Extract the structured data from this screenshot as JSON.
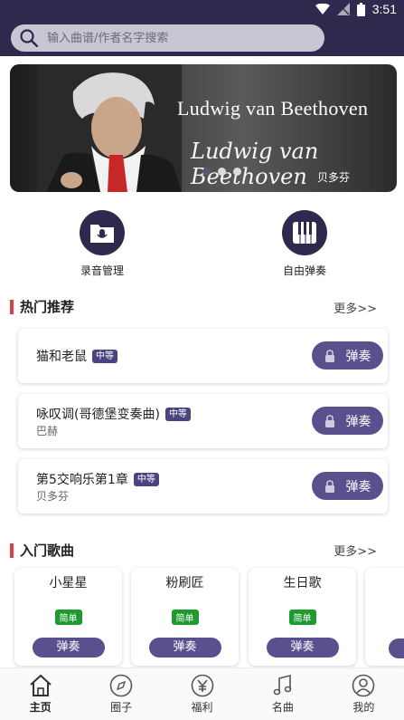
{
  "status": {
    "time": "3:51"
  },
  "search": {
    "placeholder": "输入曲谱/作者名字搜索"
  },
  "banner": {
    "title": "Ludwig van Beethoven",
    "signature": "Ludwig van Beethoven",
    "subtitle": "贝多芬"
  },
  "quick": [
    {
      "label": "录音管理",
      "icon": "microphone-folder-icon"
    },
    {
      "label": "自由弹奏",
      "icon": "piano-icon"
    }
  ],
  "hot": {
    "title": "热门推荐",
    "more": "更多>>",
    "items": [
      {
        "name": "猫和老鼠",
        "level": "中等",
        "author": "",
        "button": "弹奏"
      },
      {
        "name": "咏叹调(哥德堡变奏曲)",
        "level": "中等",
        "author": "巴赫",
        "button": "弹奏"
      },
      {
        "name": "第5交响乐第1章",
        "level": "中等",
        "author": "贝多芬",
        "button": "弹奏"
      }
    ]
  },
  "intro": {
    "title": "入门歌曲",
    "more": "更多>>",
    "items": [
      {
        "name": "小星星",
        "level": "简单",
        "button": "弹奏"
      },
      {
        "name": "粉刷匠",
        "level": "简单",
        "button": "弹奏"
      },
      {
        "name": "生日歌",
        "level": "简单",
        "button": "弹奏"
      }
    ]
  },
  "tabs": [
    {
      "label": "主页",
      "icon": "home-icon"
    },
    {
      "label": "圈子",
      "icon": "compass-icon"
    },
    {
      "label": "福利",
      "icon": "yen-icon"
    },
    {
      "label": "名曲",
      "icon": "music-note-icon"
    },
    {
      "label": "我的",
      "icon": "user-icon"
    }
  ],
  "colors": {
    "header": "#2e2a4d",
    "accent": "#5c4f8d",
    "easy": "#1e9b2f",
    "section_bar": "#d8414b"
  }
}
